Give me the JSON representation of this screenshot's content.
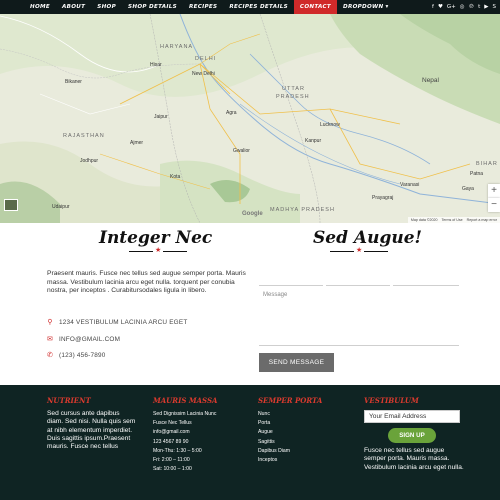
{
  "nav": {
    "items": [
      {
        "label": "HOME"
      },
      {
        "label": "ABOUT"
      },
      {
        "label": "SHOP"
      },
      {
        "label": "SHOP DETAILS"
      },
      {
        "label": "RECIPES"
      },
      {
        "label": "RECIPES DETAILS"
      },
      {
        "label": "CONTACT",
        "active": true
      },
      {
        "label": "DROPDOWN"
      }
    ],
    "social_icons": [
      "facebook-icon",
      "twitter-icon",
      "google-plus-icon",
      "instagram-icon",
      "pinterest-icon",
      "tumblr-icon",
      "youtube-icon",
      "skype-icon"
    ],
    "active_color": "#d02a2a",
    "bg_color": "#0f1a1b"
  },
  "map": {
    "regions": [
      "HARYANA",
      "DELHI",
      "UTTAR",
      "PRADESH",
      "RAJASTHAN",
      "BIHAR",
      "MADHYA PRADESH"
    ],
    "cities": [
      "Hisar",
      "Bikaner",
      "Jaipur",
      "New Delhi",
      "Agra",
      "Lucknow",
      "Kanpur",
      "Ajmer",
      "Jodhpur",
      "Kota",
      "Gwalior",
      "Varanasi",
      "Patna",
      "Gaya",
      "Prayagraj",
      "Udaipur",
      "Nepal"
    ],
    "footer": [
      "Map data ©2020",
      "Terms of Use",
      "Report a map error"
    ],
    "google": "Google"
  },
  "contact": {
    "left_heading": "Integer Nec",
    "right_heading": "Sed Augue!",
    "paragraph": "Praesent mauris. Fusce nec tellus sed augue semper porta. Mauris massa. Vestibulum lacinia arcu eget nulla. torquent per conubia nostra, per inceptos . Curabitursodales ligula in libero.",
    "address": "1234 VESTIBULUM LACINIA ARCU EGET",
    "email": "INFO@GMAIL.COM",
    "phone": "(123) 456-7890",
    "accent_color": "#d02a2a"
  },
  "form": {
    "message_placeholder": "Message",
    "send_label": "SEND MESSAGE"
  },
  "footer": {
    "col1": {
      "heading": "NUTRIENT",
      "text": "Sed cursus ante dapibus diam. Sed nisi. Nulla quis sem at nibh elementum imperdiet. Duis sagittis ipsum.Praesent mauris. Fusce nec tellus"
    },
    "col2": {
      "heading": "MAURIS MASSA",
      "lines": [
        "Sed Dignissim Lacinia Nunc",
        "Fusce Nec Tellus",
        "info@gmail.com",
        "123 4567 89 90",
        "Mon-Thu: 1:30 – 5:00",
        "Fri: 2:00 – 11:00",
        "Sat: 10:00 – 1:00"
      ]
    },
    "col3": {
      "heading": "SEMPER PORTA",
      "lines": [
        "Nunc",
        "Porta",
        "Augue",
        "Sagittis",
        "Dapibus Diam",
        "Inceptos"
      ]
    },
    "col4": {
      "heading": "VESTIBULUM",
      "input_value": "Your Email Address",
      "button_label": "SIGN UP",
      "text": "Fusce nec tellus sed augue semper porta. Mauris massa. Vestibulum lacinia arcu eget nulla."
    },
    "heading_color": "#d93a2e",
    "bg_color": "#0f2423",
    "button_color": "#6aa33a"
  }
}
